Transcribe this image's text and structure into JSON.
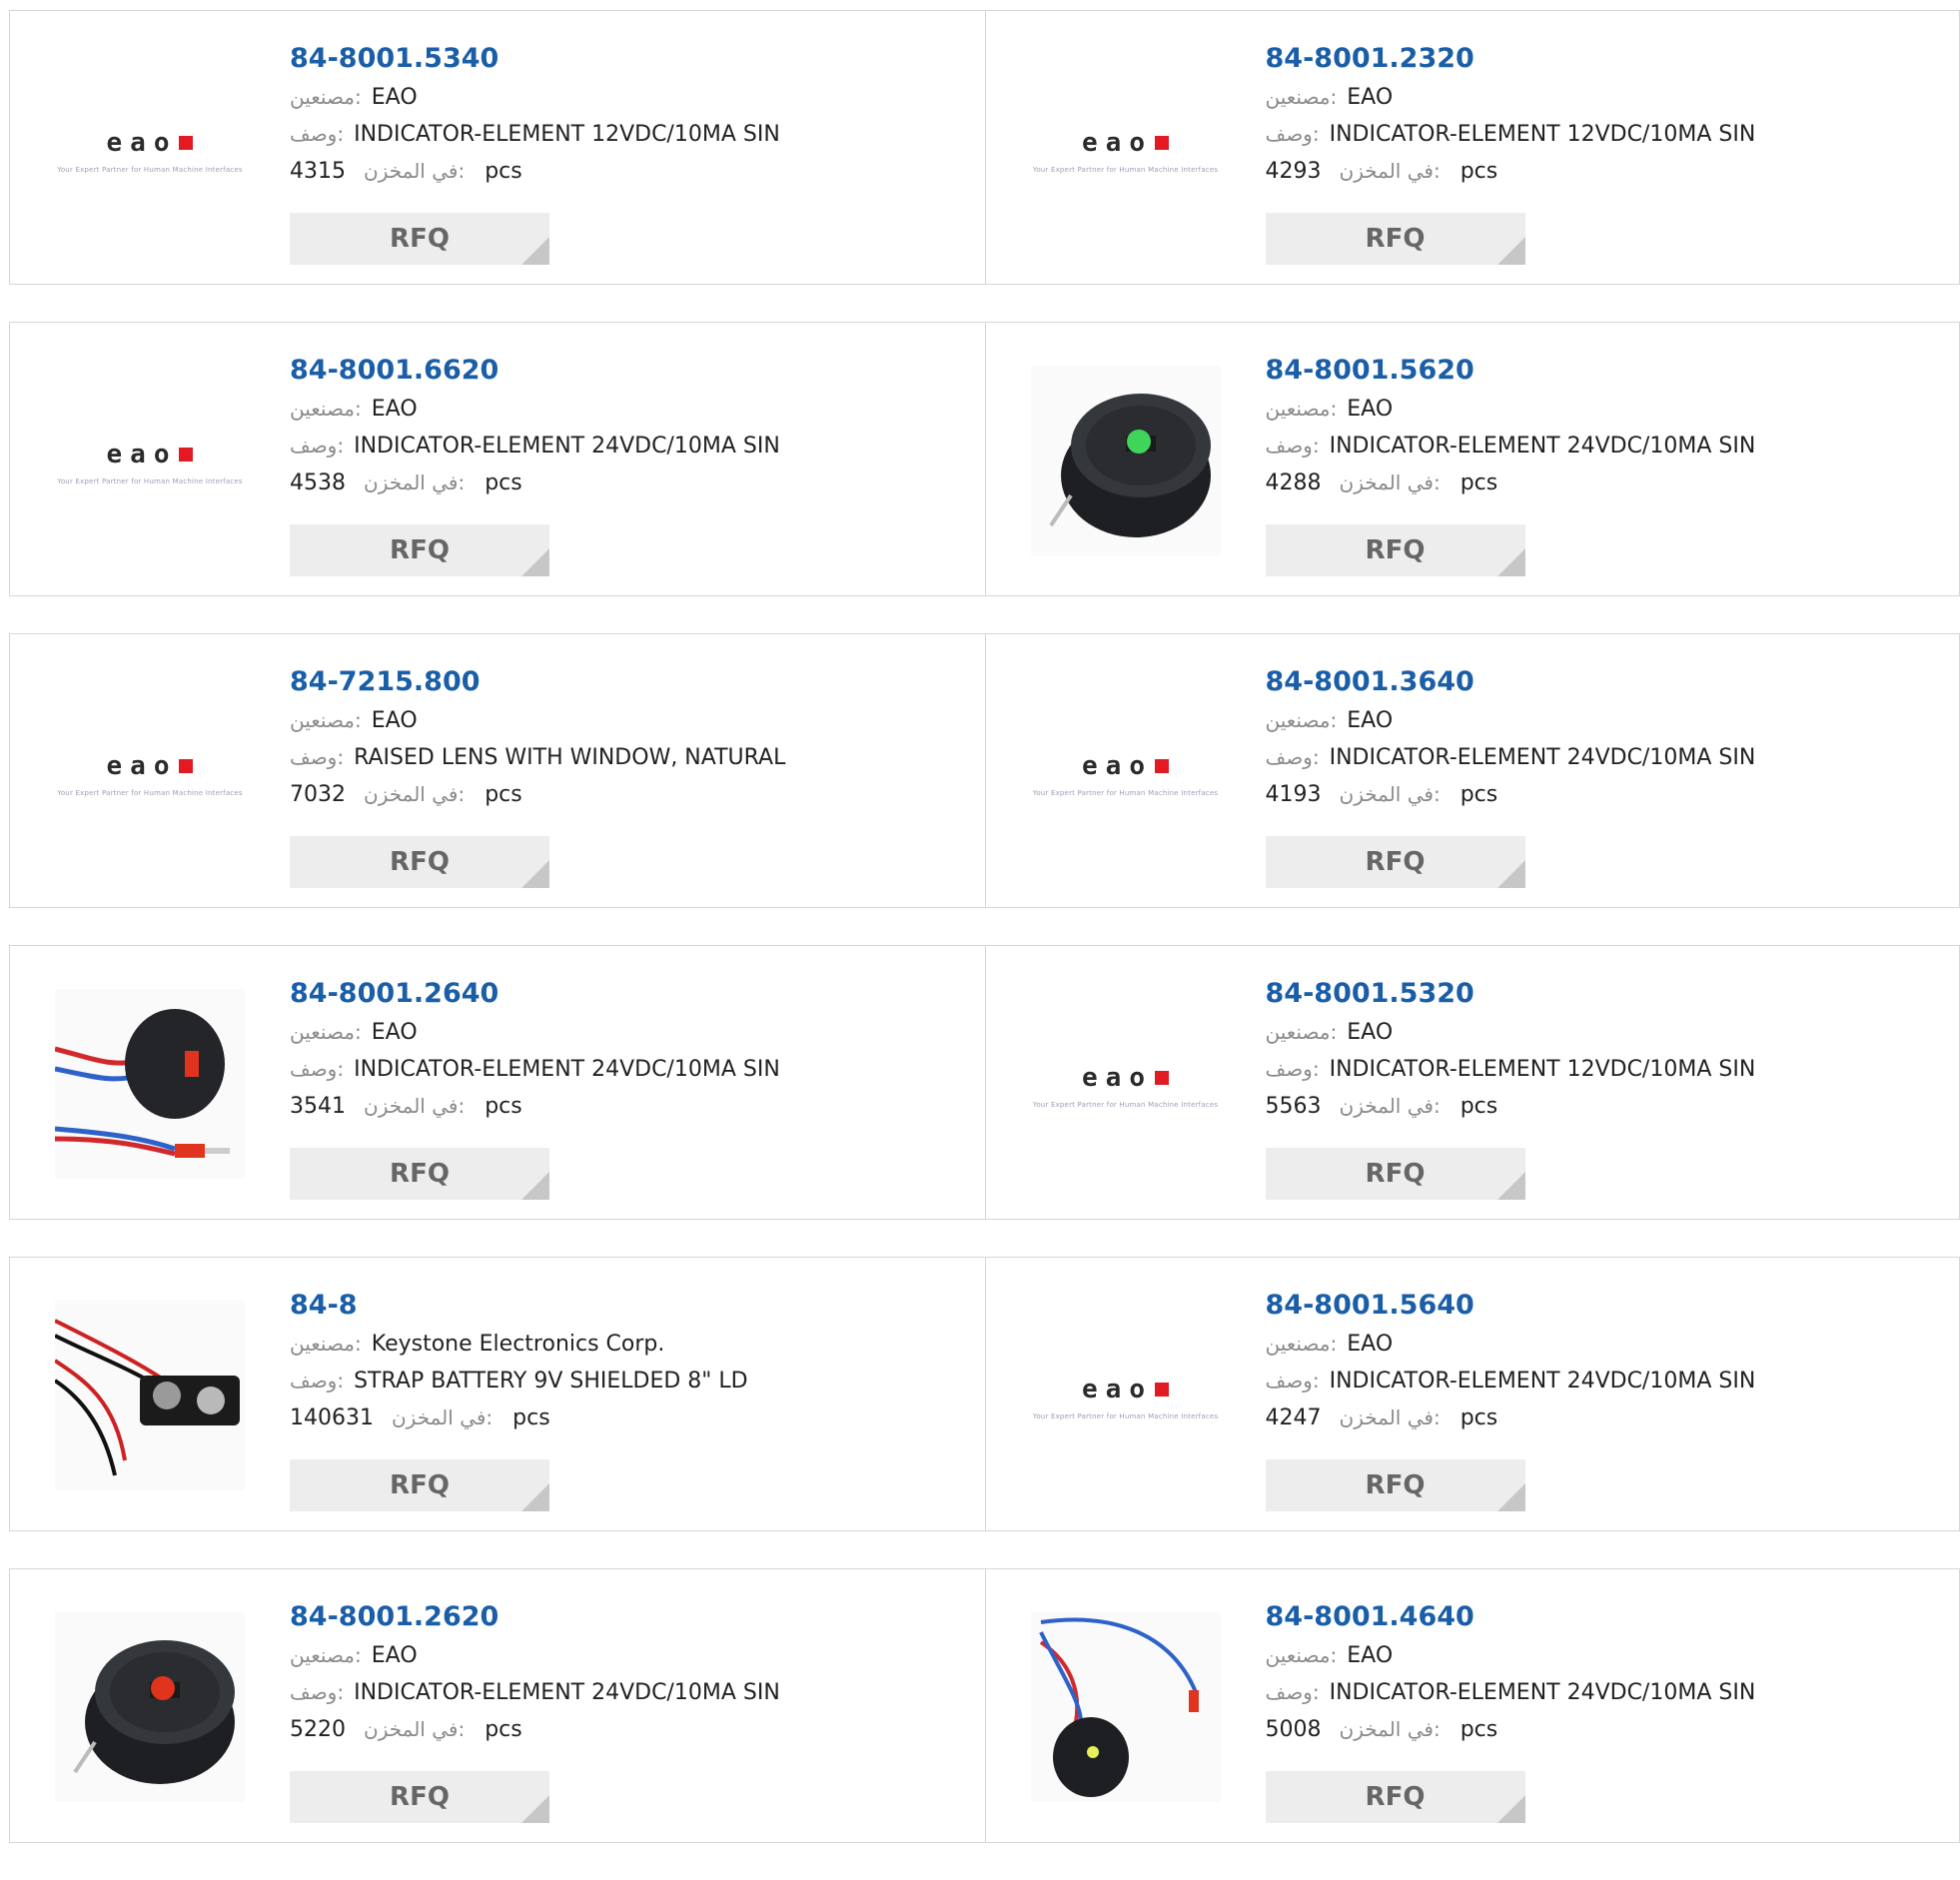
{
  "labels": {
    "manufacturer": "مصنعين:",
    "description": "وصف:",
    "stock": "في المخزن:",
    "unit": "pcs",
    "rfq": "RFQ"
  },
  "logo": {
    "brand": "eao",
    "tagline": "Your Expert Partner for Human Machine Interfaces",
    "accent": "#e21b22"
  },
  "colors": {
    "link": "#1a5ea8",
    "label": "#8a8a8a",
    "button_bg": "#ededed"
  },
  "products": [
    {
      "part": "84-8001.5340",
      "mfr": "EAO",
      "desc": "INDICATOR-ELEMENT 12VDC/10MA SIN",
      "stock": "4315",
      "image": "eao-logo"
    },
    {
      "part": "84-8001.2320",
      "mfr": "EAO",
      "desc": "INDICATOR-ELEMENT 12VDC/10MA SIN",
      "stock": "4293",
      "image": "eao-logo"
    },
    {
      "part": "84-8001.6620",
      "mfr": "EAO",
      "desc": "INDICATOR-ELEMENT 24VDC/10MA SIN",
      "stock": "4538",
      "image": "eao-logo"
    },
    {
      "part": "84-8001.5620",
      "mfr": "EAO",
      "desc": "INDICATOR-ELEMENT 24VDC/10MA SIN",
      "stock": "4288",
      "image": "indicator-green"
    },
    {
      "part": "84-7215.800",
      "mfr": "EAO",
      "desc": "RAISED LENS WITH WINDOW, NATURAL",
      "stock": "7032",
      "image": "eao-logo"
    },
    {
      "part": "84-8001.3640",
      "mfr": "EAO",
      "desc": "INDICATOR-ELEMENT 24VDC/10MA SIN",
      "stock": "4193",
      "image": "eao-logo"
    },
    {
      "part": "84-8001.2640",
      "mfr": "EAO",
      "desc": "INDICATOR-ELEMENT 24VDC/10MA SIN",
      "stock": "3541",
      "image": "indicator-wired-red"
    },
    {
      "part": "84-8001.5320",
      "mfr": "EAO",
      "desc": "INDICATOR-ELEMENT 12VDC/10MA SIN",
      "stock": "5563",
      "image": "eao-logo"
    },
    {
      "part": "84-8",
      "mfr": "Keystone Electronics Corp.",
      "desc": "STRAP BATTERY 9V SHIELDED 8\" LD",
      "stock": "140631",
      "image": "battery-snap"
    },
    {
      "part": "84-8001.5640",
      "mfr": "EAO",
      "desc": "INDICATOR-ELEMENT 24VDC/10MA SIN",
      "stock": "4247",
      "image": "eao-logo"
    },
    {
      "part": "84-8001.2620",
      "mfr": "EAO",
      "desc": "INDICATOR-ELEMENT 24VDC/10MA SIN",
      "stock": "5220",
      "image": "indicator-red"
    },
    {
      "part": "84-8001.4640",
      "mfr": "EAO",
      "desc": "INDICATOR-ELEMENT 24VDC/10MA SIN",
      "stock": "5008",
      "image": "indicator-wired-green"
    }
  ]
}
